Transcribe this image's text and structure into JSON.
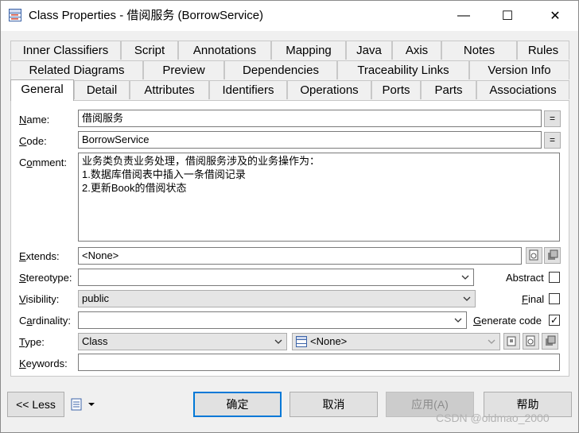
{
  "window": {
    "title": "Class Properties - 借阅服务 (BorrowService)",
    "minimize_glyph": "—",
    "maximize_glyph": "☐",
    "close_glyph": "✕"
  },
  "tabs": {
    "row1": [
      "Inner Classifiers",
      "Script",
      "Annotations",
      "Mapping",
      "Java",
      "Axis",
      "Notes",
      "Rules"
    ],
    "row2": [
      "Related Diagrams",
      "Preview",
      "Dependencies",
      "Traceability Links",
      "Version Info"
    ],
    "row3": [
      "General",
      "Detail",
      "Attributes",
      "Identifiers",
      "Operations",
      "Ports",
      "Parts",
      "Associations"
    ],
    "active": "General"
  },
  "form": {
    "name_label": "Name:",
    "name_value": "借阅服务",
    "code_label": "Code:",
    "code_value": "BorrowService",
    "equals_glyph": "=",
    "comment_label": "Comment:",
    "comment_lines": [
      "业务类负责业务处理，借阅服务涉及的业务操作为：",
      "1.数据库借阅表中插入一条借阅记录",
      "2.更新Book的借阅状态"
    ],
    "extends_label": "Extends:",
    "extends_value": "<None>",
    "stereotype_label": "Stereotype:",
    "stereotype_value": "",
    "abstract_label": "Abstract",
    "abstract_checked": false,
    "visibility_label": "Visibility:",
    "visibility_value": "public",
    "final_label": "Final",
    "final_checked": false,
    "cardinality_label": "Cardinality:",
    "cardinality_value": "",
    "generate_code_label": "Generate code",
    "generate_code_checked": true,
    "check_glyph": "✓",
    "type_label": "Type:",
    "type_value": "Class",
    "type_ref_value": "<None>",
    "keywords_label": "Keywords:",
    "keywords_value": ""
  },
  "footer": {
    "less_label": "<< Less",
    "ok_label": "确定",
    "cancel_label": "取消",
    "apply_label": "应用(A)",
    "help_label": "帮助"
  },
  "watermark": "CSDN @oldmao_2000"
}
